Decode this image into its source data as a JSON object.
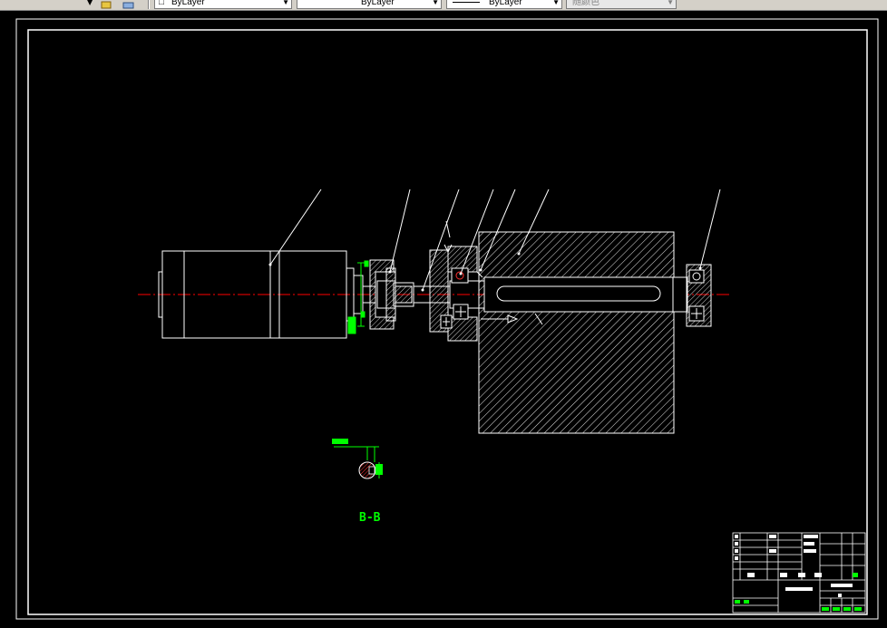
{
  "toolbar": {
    "layer_dropdown": {
      "value": "ByLayer"
    },
    "color_dropdown": {
      "value": "ByLayer"
    },
    "linetype_dropdown": {
      "value": "ByLayer"
    },
    "lineweight_dropdown": {
      "value": "随颜色"
    }
  },
  "drawing": {
    "section_label": "B-B",
    "colors": {
      "background": "#000000",
      "lines": "#ffffff",
      "centerline": "#ff0000",
      "dimensions": "#00ff00",
      "section_fill": "#ff3030"
    }
  }
}
